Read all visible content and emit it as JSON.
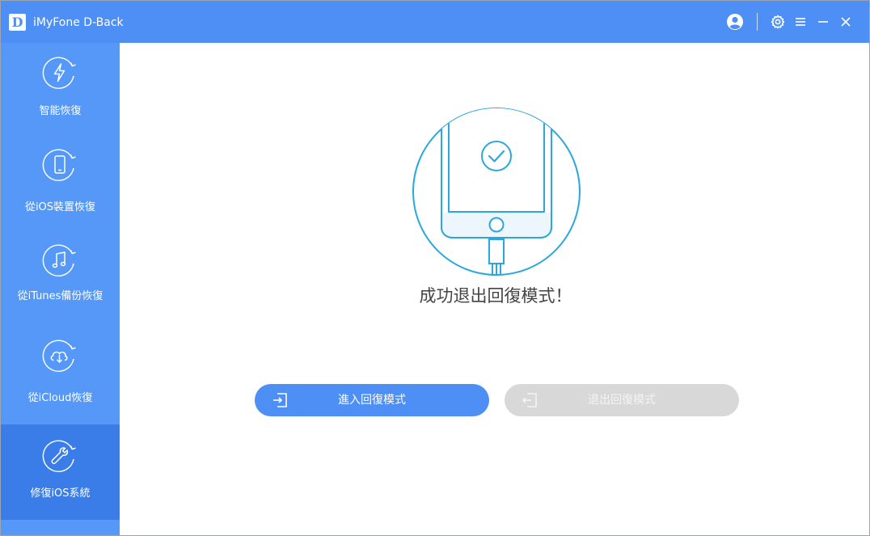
{
  "window": {
    "logo_letter": "D",
    "title": "iMyFone D-Back"
  },
  "titlebar_icons": [
    "user-account-icon",
    "settings-icon",
    "menu-icon",
    "minimize-icon",
    "close-icon"
  ],
  "sidebar": {
    "items": [
      {
        "label": "智能恢復",
        "icon": "smart-recovery-icon",
        "active": false
      },
      {
        "label": "從iOS裝置恢復",
        "icon": "ios-device-icon",
        "active": false
      },
      {
        "label": "從iTunes備份恢復",
        "icon": "itunes-music-icon",
        "active": false
      },
      {
        "label": "從iCloud恢復",
        "icon": "icloud-download-icon",
        "active": false
      },
      {
        "label": "修復iOS系統",
        "icon": "wrench-repair-icon",
        "active": true
      }
    ]
  },
  "main": {
    "status_message": "成功退出回復模式！",
    "enter_button_label": "進入回復模式",
    "exit_button_label": "退出回復模式",
    "exit_button_enabled": false
  },
  "colors": {
    "accent": "#4e8ff5",
    "sidebar_bg": "#5598f7",
    "sidebar_active": "#3a7de8",
    "illustration_stroke": "#2aa8dc",
    "disabled_button": "#d8d8d8"
  }
}
